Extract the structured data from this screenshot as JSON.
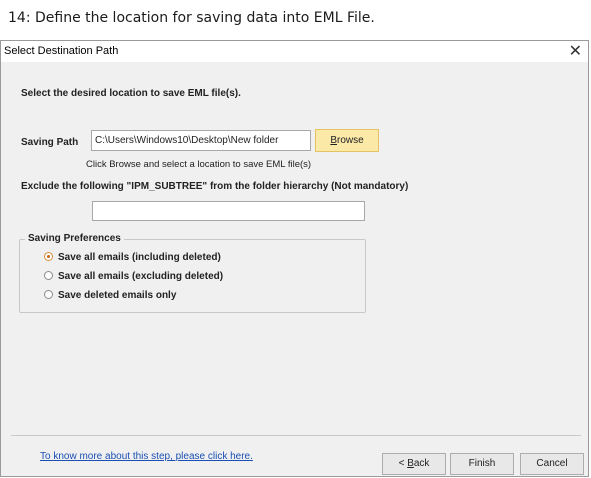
{
  "caption": "14: Define the location for saving data into EML File.",
  "window": {
    "title": "Select Destination Path",
    "close_glyph": "✕"
  },
  "instruction": "Select the desired location to save EML file(s).",
  "saving_path": {
    "label": "Saving Path",
    "value": "C:\\Users\\Windows10\\Desktop\\New folder",
    "browse_label_ul": "B",
    "browse_label_rest": "rowse",
    "hint": "Click Browse and select a location to save EML file(s)"
  },
  "exclude": {
    "label": "Exclude the following \"IPM_SUBTREE\" from the folder hierarchy (Not mandatory)",
    "value": ""
  },
  "preferences": {
    "legend": "Saving Preferences",
    "options": [
      {
        "label": "Save all emails (including deleted)",
        "checked": true
      },
      {
        "label": "Save all emails (excluding deleted)",
        "checked": false
      },
      {
        "label": "Save deleted emails only",
        "checked": false
      }
    ]
  },
  "footer": {
    "help_link": "To know more about this step, please click here.",
    "back_prefix": "< ",
    "back_ul": "B",
    "back_rest": "ack",
    "finish": "Finish",
    "cancel": "Cancel"
  },
  "colors": {
    "browse_bg": "#fbe9a8",
    "link": "#1a4fb3",
    "dialog_bg": "#f0f0f0"
  }
}
